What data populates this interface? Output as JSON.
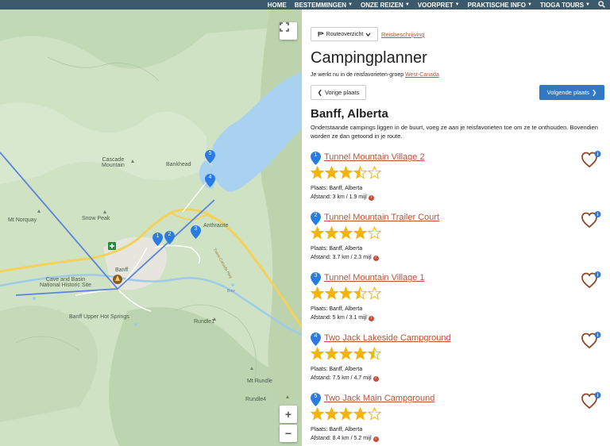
{
  "nav": {
    "items": [
      {
        "label": "HOME",
        "chevron": false
      },
      {
        "label": "BESTEMMINGEN",
        "chevron": true
      },
      {
        "label": "ONZE REIZEN",
        "chevron": true
      },
      {
        "label": "VOORPRET",
        "chevron": true
      },
      {
        "label": "PRAKTISCHE INFO",
        "chevron": true
      },
      {
        "label": "TIOGA TOURS",
        "chevron": true
      }
    ]
  },
  "map": {
    "labels": {
      "cascade": "Cascade\nMountain",
      "bankhead": "Bankhead",
      "norquay": "Mt Norquay",
      "snowpeak": "Snow Peak",
      "anthracite": "Anthracite",
      "banff": "Banff",
      "cavebasin": "Cave and Basin\nNational Historic Site",
      "hotsprings": "Banff Upper Hot Springs",
      "rundle1": "Rundle1",
      "mtrundle": "Mt Rundle",
      "rundle4": "Rundle4",
      "bow": "Bow",
      "tunnel": "Tunnel Mountain Rd",
      "canmore": "Trans-Canada Hwy"
    },
    "zoom_in": "+",
    "zoom_out": "−",
    "fullscreen": "⛶"
  },
  "panel": {
    "route_select": "Routeoverzicht",
    "route_link": "Reisbeschrijving",
    "title": "Campingplanner",
    "group_prefix": "Je werkt nu in de reisfavorieten-groep ",
    "group_link": "West-Canada",
    "prev_label": "Vorige plaats",
    "next_label": "Volgende plaats",
    "place_title": "Banff, Alberta",
    "intro": "Onderstaande campings liggen in de buurt, voeg ze aan je reisfavorieten toe om ze te onthouden. Bovendien worden ze dan getoond in je route."
  },
  "campings": [
    {
      "num": "1",
      "name": "Tunnel Mountain Village 2",
      "rating": 3.5,
      "place": "Plaats: Banff, Alberta",
      "distance": "Afstand: 3 km / 1.9 mijl"
    },
    {
      "num": "2",
      "name": "Tunnel Mountain Trailer Court",
      "rating": 4,
      "place": "Plaats: Banff, Alberta",
      "distance": "Afstand: 3.7 km / 2.3 mijl"
    },
    {
      "num": "3",
      "name": "Tunnel Mountain Village 1",
      "rating": 3.5,
      "place": "Plaats: Banff, Alberta",
      "distance": "Afstand: 5 km / 3.1 mijl"
    },
    {
      "num": "4",
      "name": "Two Jack Lakeside Campground",
      "rating": 4.5,
      "place": "Plaats: Banff, Alberta",
      "distance": "Afstand: 7.5 km / 4.7 mijl"
    },
    {
      "num": "5",
      "name": "Two Jack Main Campground",
      "rating": 4,
      "place": "Plaats: Banff, Alberta",
      "distance": "Afstand: 8.4 km / 5.2 mijl"
    }
  ],
  "colors": {
    "nav_bg": "#3a5a6b",
    "link": "#c0503c",
    "primary": "#3178c6",
    "star": "#f5b400",
    "pin": "#2a7be4"
  }
}
